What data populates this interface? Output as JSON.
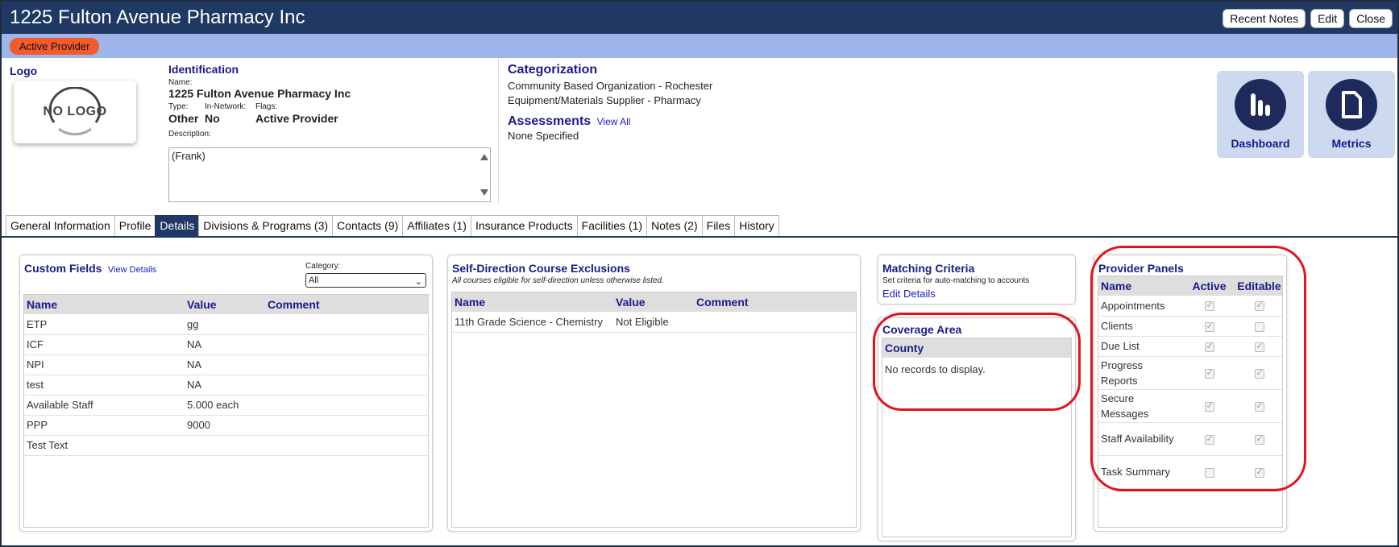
{
  "window": {
    "title": "1225 Fulton Avenue Pharmacy Inc",
    "buttons": {
      "recent_notes": "Recent Notes",
      "edit": "Edit",
      "close": "Close"
    }
  },
  "status": {
    "badge": "Active Provider",
    "badge_color": "#f45a2c"
  },
  "logo": {
    "label": "Logo",
    "placeholder": "NO LOGO"
  },
  "identification": {
    "title": "Identification",
    "name_label": "Name:",
    "name": "1225 Fulton Avenue Pharmacy Inc",
    "type_label": "Type:",
    "type": "Other",
    "in_network_label": "In-Network:",
    "in_network": "No",
    "flags_label": "Flags:",
    "flags": "Active Provider",
    "description_label": "Description:",
    "description": "(Frank)"
  },
  "categorization": {
    "title": "Categorization",
    "items": [
      "Community Based Organization - Rochester",
      "Equipment/Materials Supplier - Pharmacy"
    ]
  },
  "assessments": {
    "title": "Assessments",
    "link": "View All",
    "value": "None Specified"
  },
  "tiles": {
    "dashboard": "Dashboard",
    "metrics": "Metrics"
  },
  "tabs": [
    "General Information",
    "Profile",
    "Details",
    "Divisions & Programs (3)",
    "Contacts (9)",
    "Affiliates (1)",
    "Insurance Products",
    "Facilities (1)",
    "Notes (2)",
    "Files",
    "History"
  ],
  "active_tab": "Details",
  "custom_fields": {
    "title": "Custom Fields",
    "link": "View Details",
    "category_label": "Category:",
    "category_value": "All",
    "columns": [
      "Name",
      "Value",
      "Comment"
    ],
    "rows": [
      [
        "ETP",
        "gg",
        ""
      ],
      [
        "ICF",
        "NA",
        ""
      ],
      [
        "NPI",
        "NA",
        ""
      ],
      [
        "test",
        "NA",
        ""
      ],
      [
        "Available Staff",
        "5.000 each",
        ""
      ],
      [
        "PPP",
        "9000",
        ""
      ],
      [
        "Test Text",
        "",
        ""
      ]
    ]
  },
  "self_direction": {
    "title": "Self-Direction Course Exclusions",
    "subtitle": "All courses eligible for self-direction unless otherwise listed.",
    "columns": [
      "Name",
      "Value",
      "Comment"
    ],
    "rows": [
      [
        "11th Grade Science - Chemistry",
        "Not Eligible",
        ""
      ]
    ]
  },
  "matching": {
    "title": "Matching Criteria",
    "subtitle": "Set criteria for auto-matching to accounts",
    "link": "Edit Details"
  },
  "coverage": {
    "title": "Coverage Area",
    "column": "County",
    "empty": "No records to display."
  },
  "provider_panels": {
    "title": "Provider Panels",
    "columns": [
      "Name",
      "Active",
      "Editable"
    ],
    "rows": [
      {
        "name": "Appointments",
        "active": true,
        "editable": true
      },
      {
        "name": "Clients",
        "active": true,
        "editable": false
      },
      {
        "name": "Due List",
        "active": true,
        "editable": true
      },
      {
        "name": "Progress Reports",
        "active": true,
        "editable": true
      },
      {
        "name": "Secure Messages",
        "active": true,
        "editable": true
      },
      {
        "name": "Staff Availability",
        "active": true,
        "editable": true
      },
      {
        "name": "Task Summary",
        "active": false,
        "editable": true
      }
    ]
  },
  "colors": {
    "navy": "#1f3864",
    "title_blue": "#1a1a8c",
    "status_bar": "#9db5e8",
    "highlight": "#e0141e"
  }
}
